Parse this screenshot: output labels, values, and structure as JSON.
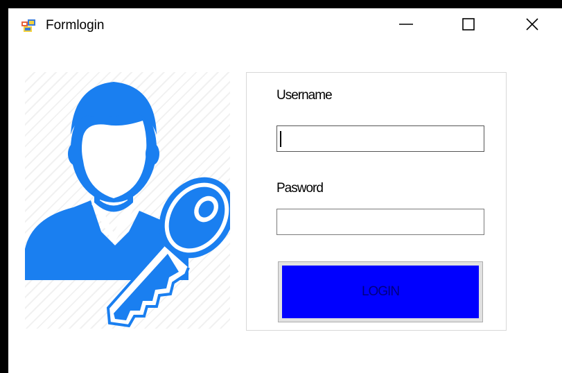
{
  "window": {
    "title": "Formlogin",
    "icon": "winforms-app-icon",
    "controls": {
      "minimize": "minimize-icon",
      "maximize": "maximize-icon",
      "close": "close-icon"
    }
  },
  "picture": {
    "icon": "user-key-icon",
    "color": "#1a7ff0"
  },
  "form": {
    "username_label": "Username",
    "username_value": "",
    "password_label": "Pasword",
    "password_value": "",
    "login_button": "LOGIN",
    "login_button_color": "#0000ff"
  }
}
